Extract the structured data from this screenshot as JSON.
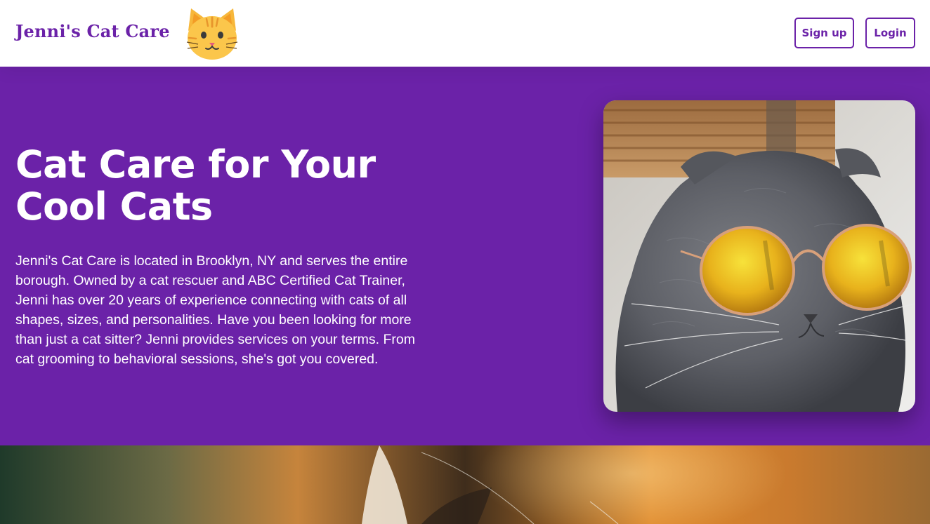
{
  "header": {
    "brand": "Jenni's Cat Care",
    "logo_icon": "cat-face-icon",
    "signup_label": "Sign up",
    "login_label": "Login"
  },
  "hero": {
    "title": "Cat Care for Your Cool Cats",
    "description": "Jenni's Cat Care is located in Brooklyn, NY and serves the entire borough. Owned by a cat rescuer and ABC Certified Cat Trainer, Jenni has over 20 years of experience connecting with cats of all shapes, sizes, and personalities. Have you been looking for more than just a cat sitter? Jenni provides services on your terms. From cat grooming to behavioral sessions, she's got you covered.",
    "photo_subject": "grey-cat-with-sunglasses"
  },
  "band": {
    "photo_subject": "blurred-cat-closeup"
  },
  "colors": {
    "brand": "#6b22a8",
    "hero_bg": "#6b22a8",
    "text_on_brand": "#ffffff"
  }
}
